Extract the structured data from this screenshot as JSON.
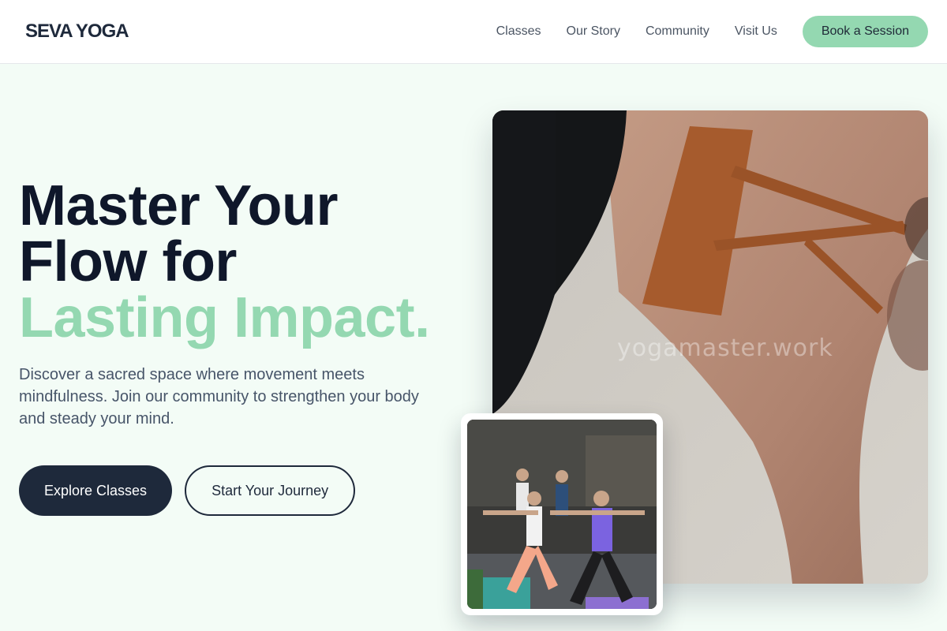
{
  "header": {
    "logo": "SEVA YOGA",
    "nav": [
      "Classes",
      "Our Story",
      "Community",
      "Visit Us"
    ],
    "cta": "Book a Session"
  },
  "hero": {
    "headline_line1": "Master Your",
    "headline_line2": "Flow for",
    "headline_accent": "Lasting Impact.",
    "description": "Discover a sacred space where movement meets mindfulness. Join our community to strengthen your body and steady your mind.",
    "primary_cta": "Explore Classes",
    "secondary_cta": "Start Your Journey"
  },
  "images": {
    "main_watermark": "yogamaster.work"
  },
  "colors": {
    "brand_dark": "#1e293b",
    "accent_green": "#94d8b1",
    "page_background": "#f3fcf6"
  }
}
